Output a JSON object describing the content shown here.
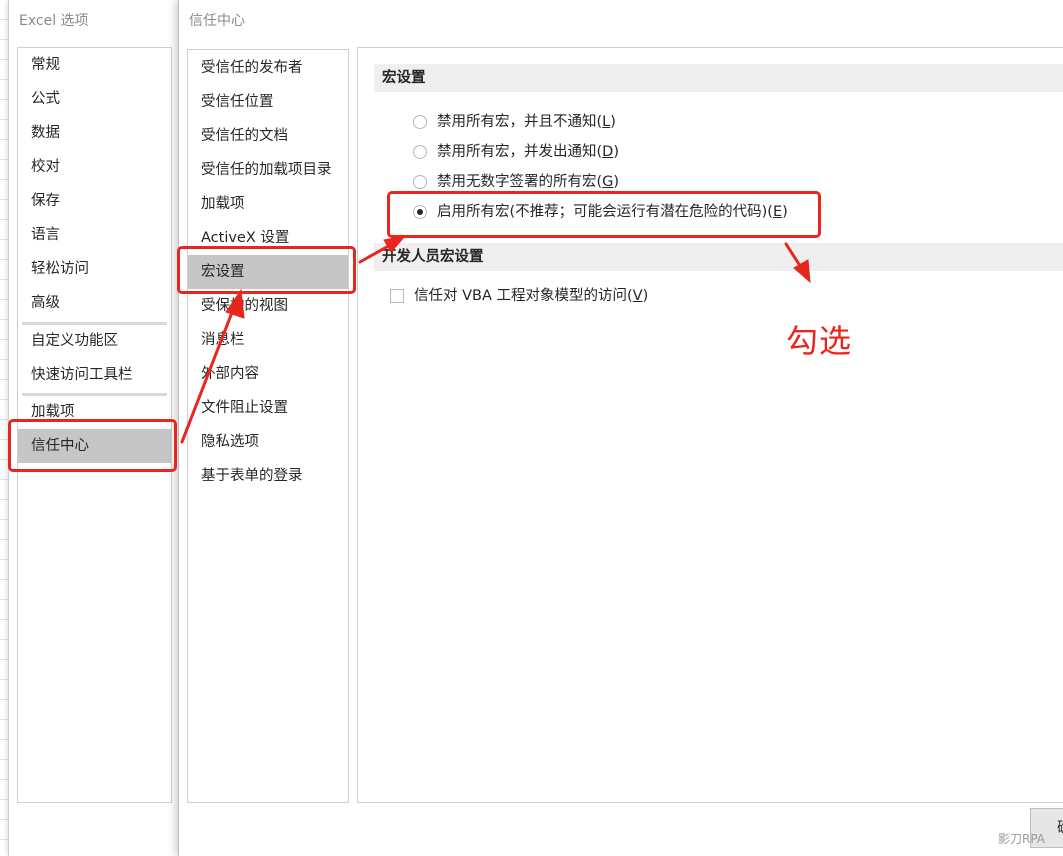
{
  "options_window": {
    "title": "Excel 选项",
    "nav_items": [
      "常规",
      "公式",
      "数据",
      "校对",
      "保存",
      "语言",
      "轻松访问",
      "高级",
      "自定义功能区",
      "快速访问工具栏",
      "加载项",
      "信任中心"
    ],
    "selected_item": "信任中心"
  },
  "trust_center": {
    "title": "信任中心",
    "nav_items": [
      "受信任的发布者",
      "受信任位置",
      "受信任的文档",
      "受信任的加载项目录",
      "加载项",
      "ActiveX 设置",
      "宏设置",
      "受保护的视图",
      "消息栏",
      "外部内容",
      "文件阻止设置",
      "隐私选项",
      "基于表单的登录"
    ],
    "selected_item": "宏设置"
  },
  "macro_settings": {
    "header": "宏设置",
    "options": [
      {
        "label": "禁用所有宏，并且不通知(",
        "key": "L",
        "suffix": ")",
        "checked": false
      },
      {
        "label": "禁用所有宏，并发出通知(",
        "key": "D",
        "suffix": ")",
        "checked": false
      },
      {
        "label": "禁用无数字签署的所有宏(",
        "key": "G",
        "suffix": ")",
        "checked": false
      },
      {
        "label": "启用所有宏(不推荐；可能会运行有潜在危险的代码)(",
        "key": "E",
        "suffix": ")",
        "checked": true
      }
    ]
  },
  "developer_settings": {
    "header": "开发人员宏设置",
    "checkbox": {
      "label": "信任对 VBA 工程对象模型的访问(",
      "key": "V",
      "suffix": ")",
      "checked": false
    }
  },
  "ok_button_label": "确",
  "annotation": {
    "text": "勾选",
    "color": "#e8261e"
  },
  "watermark": "影刀RPA"
}
